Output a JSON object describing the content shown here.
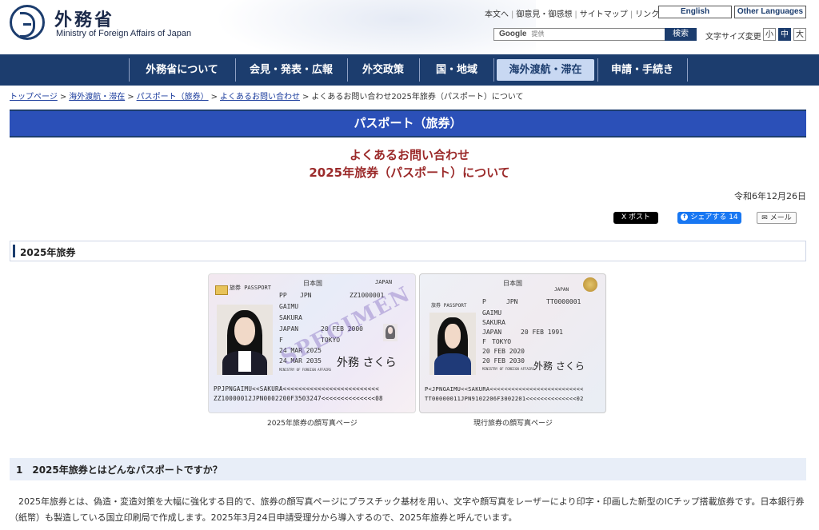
{
  "header": {
    "logo_jp": "外務省",
    "logo_en": "Ministry of Foreign Affairs of Japan",
    "util_links": [
      "本文へ",
      "御意見・御感想",
      "サイトマップ",
      "リンク集"
    ],
    "english_label": "English",
    "other_languages_label": "Other Languages",
    "search_google": "Google",
    "search_powered": "提供",
    "search_button": "検索",
    "font_size_label": "文字サイズ変更",
    "font_sizes": [
      "小",
      "中",
      "大"
    ]
  },
  "nav": {
    "items": [
      "外務省について",
      "会見・発表・広報",
      "外交政策",
      "国・地域",
      "海外渡航・滞在",
      "申請・手続き"
    ],
    "active": "海外渡航・滞在"
  },
  "breadcrumb": {
    "links": [
      "トップページ",
      "海外渡航・滞在",
      "パスポート（旅券）",
      "よくあるお問い合わせ"
    ],
    "current": "よくあるお問い合わせ2025年旅券（パスポート）について"
  },
  "section_banner": "パスポート（旅券）",
  "title": {
    "line1": "よくあるお問い合わせ",
    "line2": "2025年旅券（パスポート）について"
  },
  "date": "令和6年12月26日",
  "share": {
    "x_label": "X ポスト",
    "fb_label": "シェアする 14",
    "mail_label": "メール"
  },
  "h2": "2025年旅券",
  "passport_new": {
    "caption": "2025年旅券の顔写真ページ",
    "header_jp": "日本国",
    "header_en": "JAPAN",
    "label_passport": "旅券 PASSPORT",
    "type": "PP",
    "country": "JPN",
    "number": "ZZ1000001",
    "surname": "GAIMU",
    "given": "SAKURA",
    "nationality": "JAPAN",
    "dob": "20 FEB 2000",
    "sex": "F",
    "domicile": "TOKYO",
    "issue": "24 MAR 2025",
    "expiry": "24 MAR 2035",
    "authority": "MINISTRY OF FOREIGN AFFAIRS",
    "signature": "外務 さくら",
    "watermark": "SPECIMEN",
    "mrz1": "PPJPNGAIMU<<SAKURA<<<<<<<<<<<<<<<<<<<<<<<<<",
    "mrz2": "ZZ10000012JPN0002200F3503247<<<<<<<<<<<<<<08"
  },
  "passport_cur": {
    "caption": "現行旅券の顔写真ページ",
    "header_jp": "日本国",
    "header_en": "JAPAN",
    "label_passport": "旅券 PASSPORT",
    "type": "P",
    "country": "JPN",
    "number": "TT0000001",
    "surname": "GAIMU",
    "given": "SAKURA",
    "nationality": "JAPAN",
    "dob": "20 FEB 1991",
    "sex": "F",
    "domicile": "TOKYO",
    "issue": "20 FEB 2020",
    "expiry": "20 FEB 2030",
    "authority": "MINISTRY OF FOREIGN AFFAIRS",
    "signature": "外務 さくら",
    "mrz1": "P<JPNGAIMU<<SAKURA<<<<<<<<<<<<<<<<<<<<<<<<<<",
    "mrz2": "TT00000011JPN9102206F3002201<<<<<<<<<<<<<<02"
  },
  "h3": "1　2025年旅券とはどんなパスポートですか？",
  "body": "2025年旅券とは、偽造・変造対策を大幅に強化する目的で、旅券の顔写真ページにプラスチック基材を用い、文字や顔写真をレーザーにより印字・印画した新型のICチップ搭載旅券です。日本銀行券（紙幣）も製造している国立印刷局で作成します。2025年3月24日申請受理分から導入するので、2025年旅券と呼んでいます。"
}
